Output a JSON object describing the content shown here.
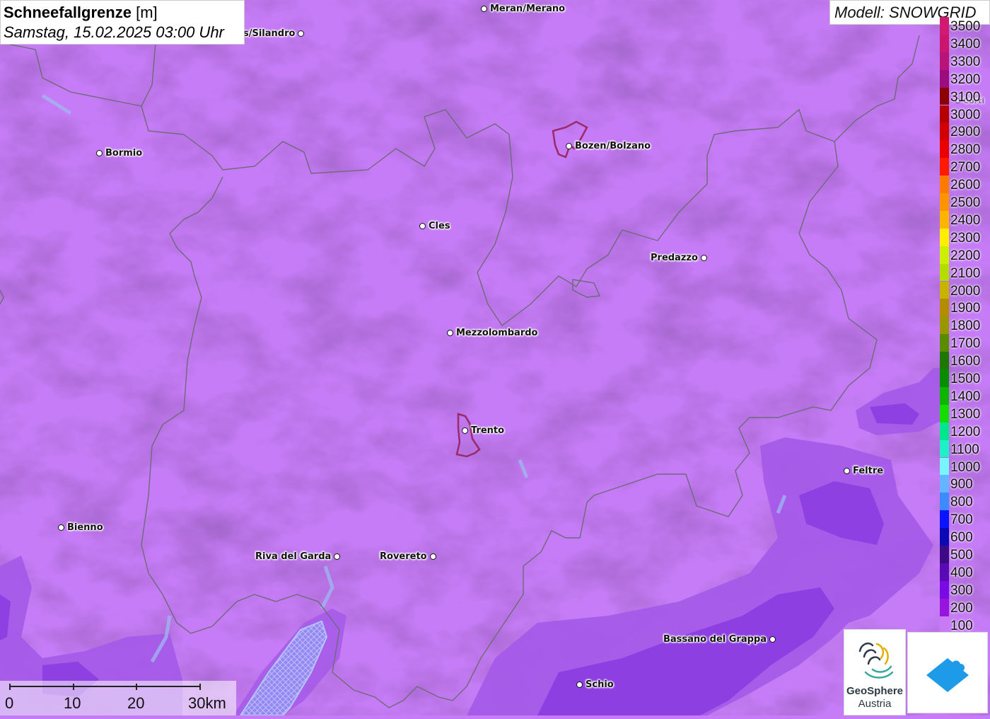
{
  "title": {
    "parameter": "Schneefallgrenze",
    "unit": "[m]",
    "datetime": "Samstag, 15.02.2025 03:00 Uhr"
  },
  "model": "Modell: SNOWGRID",
  "legend": {
    "levels": [
      {
        "label": "3500",
        "color": "#d21a73"
      },
      {
        "label": "3400",
        "color": "#cc166e"
      },
      {
        "label": "3300",
        "color": "#b81377"
      },
      {
        "label": "3200",
        "color": "#9c0c7c"
      },
      {
        "label": "3100",
        "color": "#8b0000"
      },
      {
        "label": "3000",
        "color": "#b60000"
      },
      {
        "label": "2900",
        "color": "#d20000"
      },
      {
        "label": "2800",
        "color": "#eb0000"
      },
      {
        "label": "2700",
        "color": "#ff1a00"
      },
      {
        "label": "2600",
        "color": "#ff7a00"
      },
      {
        "label": "2500",
        "color": "#ff9400"
      },
      {
        "label": "2400",
        "color": "#ffb400"
      },
      {
        "label": "2300",
        "color": "#ffee00"
      },
      {
        "label": "2200",
        "color": "#ccee00"
      },
      {
        "label": "2100",
        "color": "#b4dc00"
      },
      {
        "label": "2000",
        "color": "#c8b400"
      },
      {
        "label": "1900",
        "color": "#b48c00"
      },
      {
        "label": "1800",
        "color": "#9a9600"
      },
      {
        "label": "1700",
        "color": "#5a8c00"
      },
      {
        "label": "1600",
        "color": "#1e7800"
      },
      {
        "label": "1500",
        "color": "#0a8c00"
      },
      {
        "label": "1400",
        "color": "#0fb400"
      },
      {
        "label": "1300",
        "color": "#14dc00"
      },
      {
        "label": "1200",
        "color": "#00e68c"
      },
      {
        "label": "1100",
        "color": "#1ef0c8"
      },
      {
        "label": "1000",
        "color": "#78f5ff"
      },
      {
        "label": "900",
        "color": "#64b4ff"
      },
      {
        "label": "800",
        "color": "#3c8cff"
      },
      {
        "label": "700",
        "color": "#0a14ff"
      },
      {
        "label": "600",
        "color": "#0a0ab4"
      },
      {
        "label": "500",
        "color": "#3c0a82"
      },
      {
        "label": "400",
        "color": "#5a0ab4"
      },
      {
        "label": "300",
        "color": "#780ae6"
      },
      {
        "label": "200",
        "color": "#9614dc"
      },
      {
        "label": "100",
        "color": "#c87af5"
      }
    ]
  },
  "cities": [
    {
      "name": "Meran/Merano",
      "side": "right"
    },
    {
      "name": "s/Silandro",
      "side": "left"
    },
    {
      "name": "Bormio",
      "side": "right"
    },
    {
      "name": "Bozen/Bolzano",
      "side": "right"
    },
    {
      "name": "Cles",
      "side": "right"
    },
    {
      "name": "Predazzo",
      "side": "left"
    },
    {
      "name": "Mezzolombardo",
      "side": "right"
    },
    {
      "name": "Trento",
      "side": "right"
    },
    {
      "name": "Feltre",
      "side": "right"
    },
    {
      "name": "Bienno",
      "side": "right"
    },
    {
      "name": "Riva del Garda",
      "side": "left"
    },
    {
      "name": "Rovereto",
      "side": "left"
    },
    {
      "name": "Bassano del Grappa",
      "side": "left"
    },
    {
      "name": "Schio",
      "side": "right"
    },
    {
      "name": "Corti",
      "side": "right"
    }
  ],
  "scalebar": {
    "labels": [
      "0",
      "10",
      "20",
      "30km"
    ]
  },
  "logos": {
    "geosphere_line1": "GeoSphere",
    "geosphere_line2": "Austria"
  },
  "colors": {
    "map_base": "#c67cf6",
    "lower_snowline": "#a45ae8",
    "lowest_snowline": "#8a3ae0",
    "water": "#a0b4f0",
    "borders": "#6e6a78",
    "city_outline": "#9a2a6a"
  }
}
